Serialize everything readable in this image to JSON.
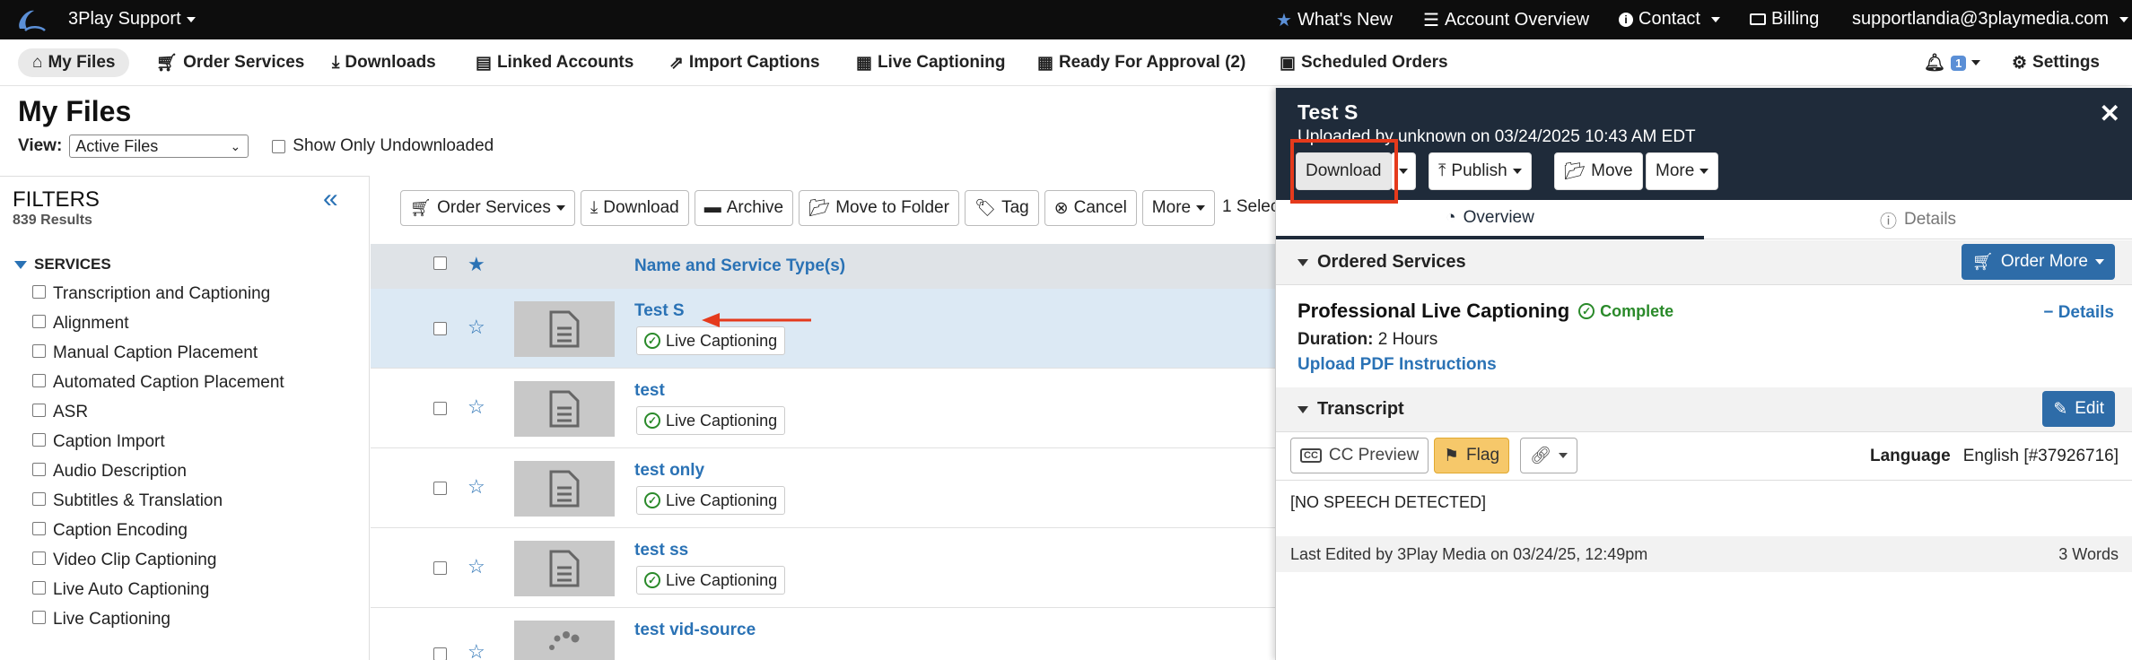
{
  "topbar": {
    "brand": "3Play Support",
    "whats_new": "What's New",
    "account_overview": "Account Overview",
    "contact": "Contact",
    "billing": "Billing",
    "user_email": "supportlandia@3playmedia.com"
  },
  "nav": {
    "my_files": "My Files",
    "order_services": "Order Services",
    "downloads": "Downloads",
    "linked_accounts": "Linked Accounts",
    "import_captions": "Import Captions",
    "live_captioning": "Live Captioning",
    "ready_for_approval": "Ready For Approval (2)",
    "scheduled_orders": "Scheduled Orders",
    "notifications_count": "1",
    "settings": "Settings"
  },
  "page": {
    "title": "My Files",
    "view_label": "View:",
    "view_value": "Active Files",
    "only_undownloaded": "Show Only Undownloaded"
  },
  "filters": {
    "title": "FILTERS",
    "count": "839 Results",
    "section": "SERVICES",
    "items": [
      "Transcription and Captioning",
      "Alignment",
      "Manual Caption Placement",
      "Automated Caption Placement",
      "ASR",
      "Caption Import",
      "Audio Description",
      "Subtitles & Translation",
      "Caption Encoding",
      "Video Clip Captioning",
      "Live Auto Captioning",
      "Live Captioning"
    ]
  },
  "toolbar": {
    "order_services": "Order Services",
    "download": "Download",
    "archive": "Archive",
    "move_to_folder": "Move to Folder",
    "tag": "Tag",
    "cancel": "Cancel",
    "more": "More",
    "selected": "1 Selec"
  },
  "table": {
    "column_name": "Name and Service Type(s)",
    "rows": [
      {
        "name": "Test S",
        "service": "Live Captioning"
      },
      {
        "name": "test",
        "service": "Live Captioning"
      },
      {
        "name": "test only",
        "service": "Live Captioning"
      },
      {
        "name": "test ss",
        "service": "Live Captioning"
      },
      {
        "name": "test vid-source",
        "service": ""
      }
    ]
  },
  "panel": {
    "title": "Test S",
    "subtitle": "Uploaded by unknown on 03/24/2025 10:43 AM EDT",
    "download": "Download",
    "publish": "Publish",
    "move": "Move",
    "more": "More",
    "tab_overview": "Overview",
    "tab_details": "Details",
    "ordered_services": "Ordered Services",
    "order_more": "Order More",
    "service_name": "Professional Live Captioning",
    "service_status": "Complete",
    "details_link": "Details",
    "duration_label": "Duration:",
    "duration_value": "2 Hours",
    "upload_pdf": "Upload PDF Instructions",
    "transcript": "Transcript",
    "edit": "Edit",
    "cc_preview": "CC Preview",
    "flag": "Flag",
    "language_label": "Language",
    "language_value": "English [#37926716]",
    "transcript_text": "[NO SPEECH DETECTED]",
    "last_edited": "Last Edited by 3Play Media on 03/24/25, 12:49pm",
    "word_count": "3 Words"
  },
  "colors": {
    "link_blue": "#2a72b5",
    "panel_header": "#1f2b3a",
    "highlight_red": "#e53a1c",
    "status_green": "#2a8a2a"
  }
}
